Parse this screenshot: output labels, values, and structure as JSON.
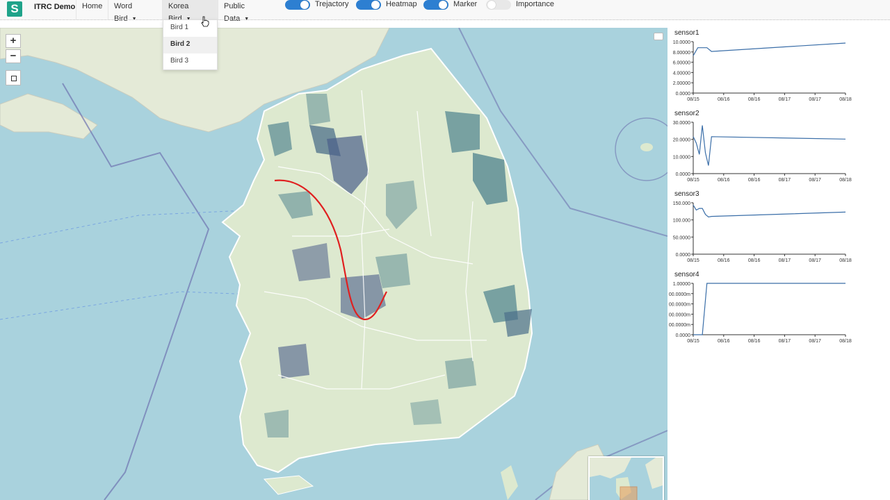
{
  "app": {
    "logo_letter": "S",
    "brand": "ITRC Demo"
  },
  "nav": {
    "home": "Home",
    "word_bird": "Word Bird",
    "korea_bird": "Korea Bird",
    "public_data": "Public Data",
    "caret": "▼"
  },
  "toggles": [
    {
      "label": "Trejactory",
      "on": true
    },
    {
      "label": "Heatmap",
      "on": true
    },
    {
      "label": "Marker",
      "on": true
    },
    {
      "label": "Importance",
      "on": false
    }
  ],
  "dropdown": {
    "items": [
      "Bird 1",
      "Bird 2",
      "Bird 3"
    ],
    "selected": "Bird 2"
  },
  "map_controls": {
    "zoom_in": "+",
    "zoom_out": "−"
  },
  "colors": {
    "accent": "#2d7fd1",
    "logo": "#1fa38a",
    "trajectory": "#e02020",
    "sea": "#a9d2dd",
    "land": "#dde9cf",
    "heat": "#5f8e95",
    "line": "#3a6ea8"
  },
  "chart_data": [
    {
      "type": "line",
      "title": "sensor1",
      "x": [
        "08/15 00:00",
        "08/15 06:00",
        "08/15 12:00",
        "08/15 18:00",
        "08/16 00:00",
        "08/18 12:00"
      ],
      "categories_ticks": [
        "08/15",
        "08/16",
        "08/16",
        "08/17",
        "08/17",
        "08/18"
      ],
      "y_ticks": [
        "0.0000",
        "2.00000",
        "4.00000",
        "6.00000",
        "8.00000",
        "10.0000"
      ],
      "ylim": [
        0,
        11
      ],
      "series": [
        {
          "values": [
            8.0,
            9.7,
            9.7,
            9.7,
            8.9,
            10.7
          ]
        }
      ]
    },
    {
      "type": "line",
      "title": "sensor2",
      "categories_ticks": [
        "08/15",
        "08/16",
        "08/16",
        "08/17",
        "08/17",
        "08/18"
      ],
      "y_ticks": [
        "0.0000",
        "10.0000",
        "20.0000",
        "30.0000"
      ],
      "ylim": [
        0,
        32
      ],
      "series": [
        {
          "values": [
            23,
            19,
            12,
            30,
            13,
            5,
            23,
            21.5
          ]
        }
      ]
    },
    {
      "type": "line",
      "title": "sensor3",
      "categories_ticks": [
        "08/15",
        "08/16",
        "08/16",
        "08/17",
        "08/17",
        "08/18"
      ],
      "y_ticks": [
        "0.0000",
        "50.0000",
        "100.000",
        "150.000"
      ],
      "ylim": [
        0,
        155
      ],
      "series": [
        {
          "values": [
            148,
            133,
            138,
            138,
            120,
            112,
            114,
            127
          ]
        }
      ]
    },
    {
      "type": "line",
      "title": "sensor4",
      "categories_ticks": [
        "08/15",
        "08/16",
        "08/16",
        "08/17",
        "08/17",
        "08/18"
      ],
      "y_ticks": [
        "0.0000",
        "00.0000m",
        "00.0000m",
        "00.0000m",
        "00.0000m",
        "1.00000"
      ],
      "ylim": [
        0,
        1
      ],
      "series": [
        {
          "values": [
            0,
            0,
            0,
            1,
            1,
            1
          ]
        }
      ]
    }
  ]
}
